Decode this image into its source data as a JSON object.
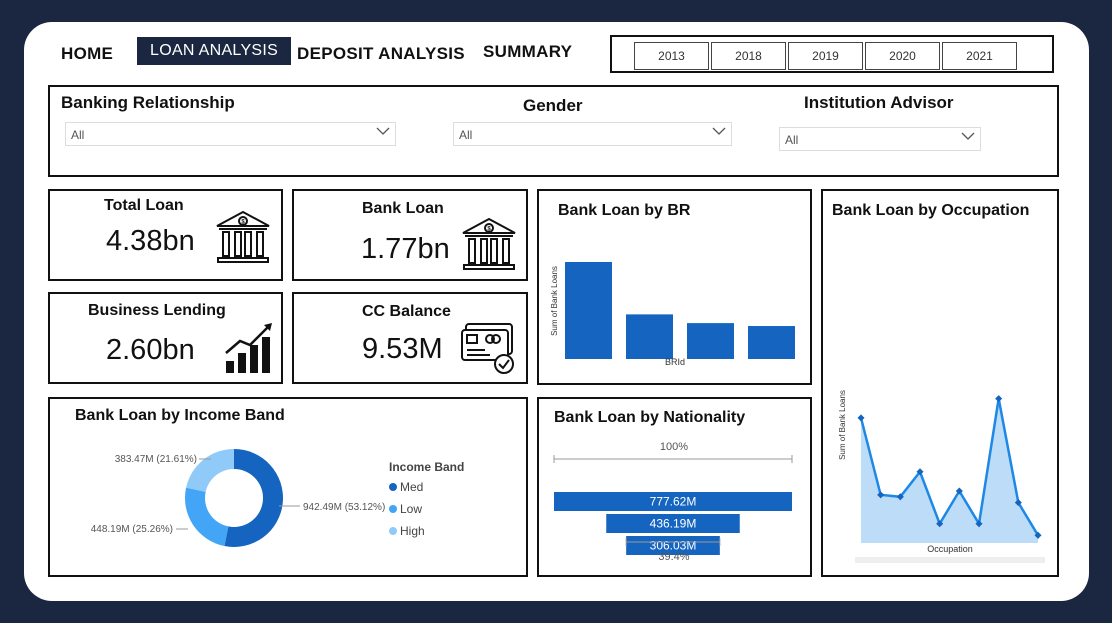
{
  "nav": {
    "home": "HOME",
    "loan_analysis": "LOAN ANALYSIS",
    "deposit_analysis": "DEPOSIT ANALYSIS",
    "summary": "SUMMARY"
  },
  "years": [
    "2013",
    "2018",
    "2019",
    "2020",
    "2021"
  ],
  "filters": {
    "banking_relationship": {
      "label": "Banking Relationship",
      "value": "All"
    },
    "gender": {
      "label": "Gender",
      "value": "All"
    },
    "institution_advisor": {
      "label": "Institution Advisor",
      "value": "All"
    }
  },
  "kpis": {
    "total_loan": {
      "title": "Total Loan",
      "value": "4.38bn"
    },
    "bank_loan": {
      "title": "Bank Loan",
      "value": "1.77bn"
    },
    "business_lending": {
      "title": "Business Lending",
      "value": "2.60bn"
    },
    "cc_balance": {
      "title": "CC Balance",
      "value": "9.53M"
    }
  },
  "colors": {
    "primary": "#1565c0",
    "med": "#1565c0",
    "low": "#42a5f5",
    "high": "#90caf9",
    "area_fill": "#bcdcf7",
    "line": "#1e88e5"
  },
  "chart_data": [
    {
      "type": "bar",
      "title": "Bank Loan by BR",
      "xlabel": "BRId",
      "ylabel": "Sum of Bank Loans",
      "categories": [
        "",
        "",
        "",
        ""
      ],
      "values": [
        100,
        46,
        37,
        34
      ]
    },
    {
      "type": "pie",
      "title": "Bank Loan by Income Band",
      "legend_title": "Income Band",
      "slices": [
        {
          "name": "Med",
          "value": 942.49,
          "label": "942.49M (53.12%)"
        },
        {
          "name": "Low",
          "value": 448.19,
          "label": "448.19M (25.26%)"
        },
        {
          "name": "High",
          "value": 383.47,
          "label": "383.47M (21.61%)"
        }
      ]
    },
    {
      "type": "bar",
      "title": "Bank Loan by Nationality",
      "values": [
        777.62,
        436.19,
        306.03
      ],
      "labels": [
        "777.62M",
        "436.19M",
        "306.03M"
      ],
      "top_pct": "100%",
      "bottom_pct": "39.4%"
    },
    {
      "type": "area",
      "title": "Bank Loan by Occupation",
      "xlabel": "Occupation",
      "ylabel": "Sum of Bank Loans",
      "values": [
        65,
        25,
        24,
        37,
        10,
        27,
        10,
        75,
        21,
        4
      ],
      "ylim": [
        0,
        80
      ]
    }
  ]
}
